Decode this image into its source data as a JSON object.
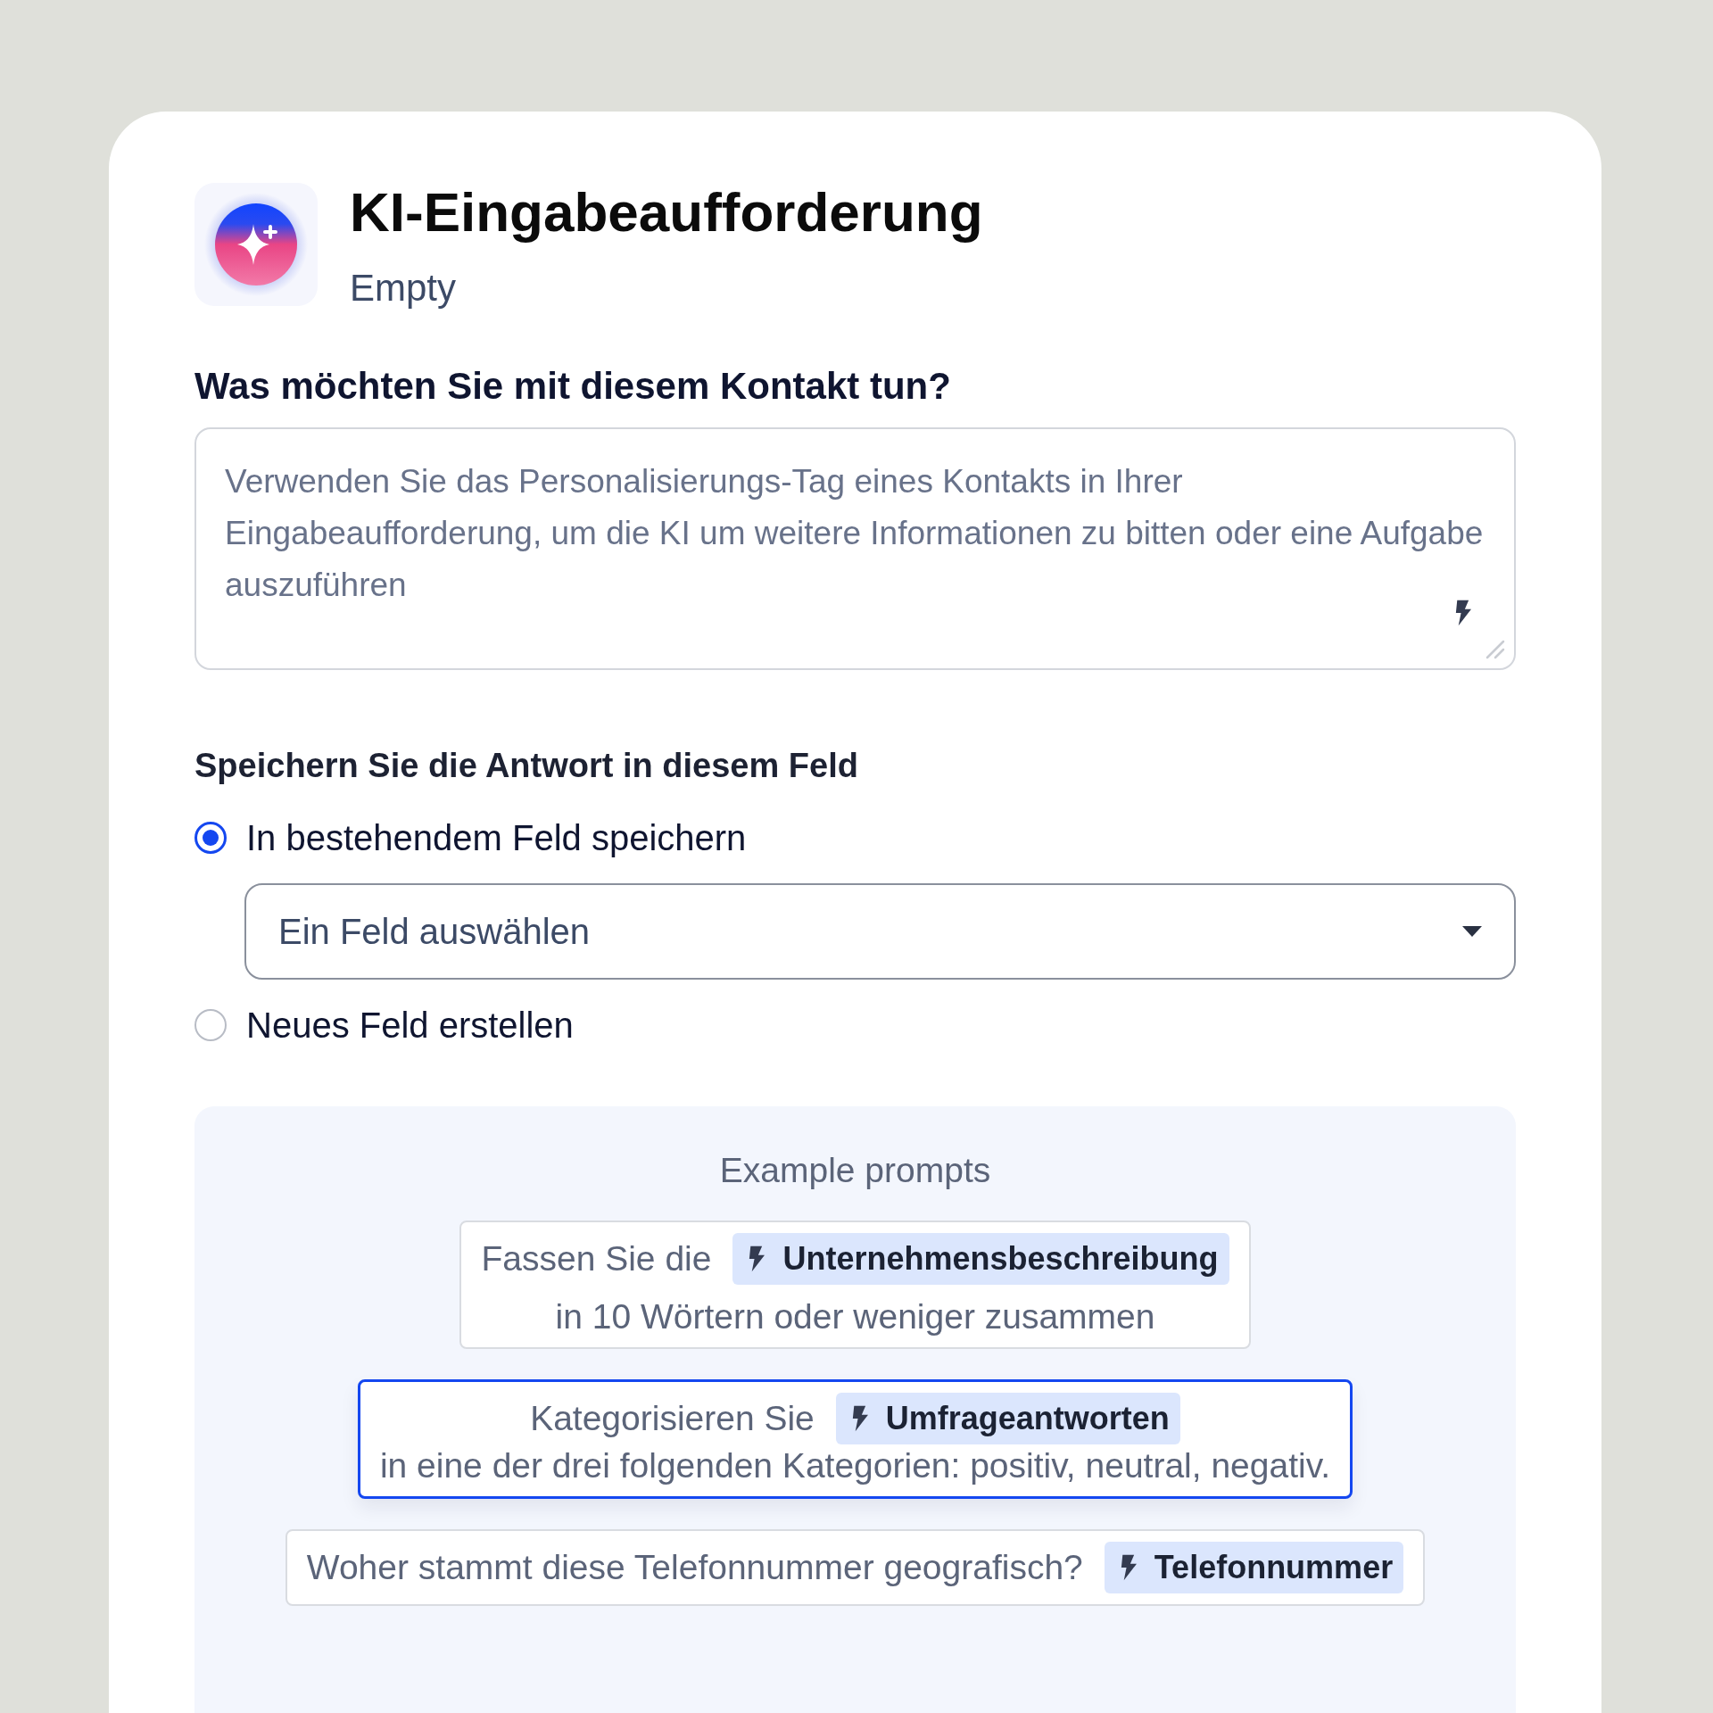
{
  "header": {
    "title": "KI-Eingabeaufforderung",
    "subtitle": "Empty"
  },
  "prompt": {
    "label": "Was möchten Sie mit diesem Kontakt tun?",
    "placeholder": "Verwenden Sie das Personalisierungs-Tag eines Kontakts in Ihrer Eingabeaufforderung, um die KI um weitere Informationen zu bitten oder eine Aufgabe auszuführen"
  },
  "save": {
    "label": "Speichern Sie die Antwort in diesem Feld",
    "options": [
      {
        "label": "In bestehendem Feld speichern",
        "selected": true,
        "select": {
          "placeholder": "Ein Feld auswählen"
        }
      },
      {
        "label": "Neues Feld erstellen",
        "selected": false
      }
    ]
  },
  "examples": {
    "title": "Example prompts",
    "items": [
      {
        "lead": "Fassen Sie die",
        "tag": "Unternehmensbeschreibung",
        "tail": "in 10 Wörtern oder weniger zusammen",
        "selected": false
      },
      {
        "lead": "Kategorisieren Sie",
        "tag": "Umfrageantworten",
        "tail": "in eine der drei folgenden Kategorien: positiv, neutral, negativ.",
        "selected": true
      },
      {
        "lead": "Woher stammt diese Telefonnummer geografisch?",
        "tag": "Telefonnummer",
        "selected": false
      }
    ]
  }
}
